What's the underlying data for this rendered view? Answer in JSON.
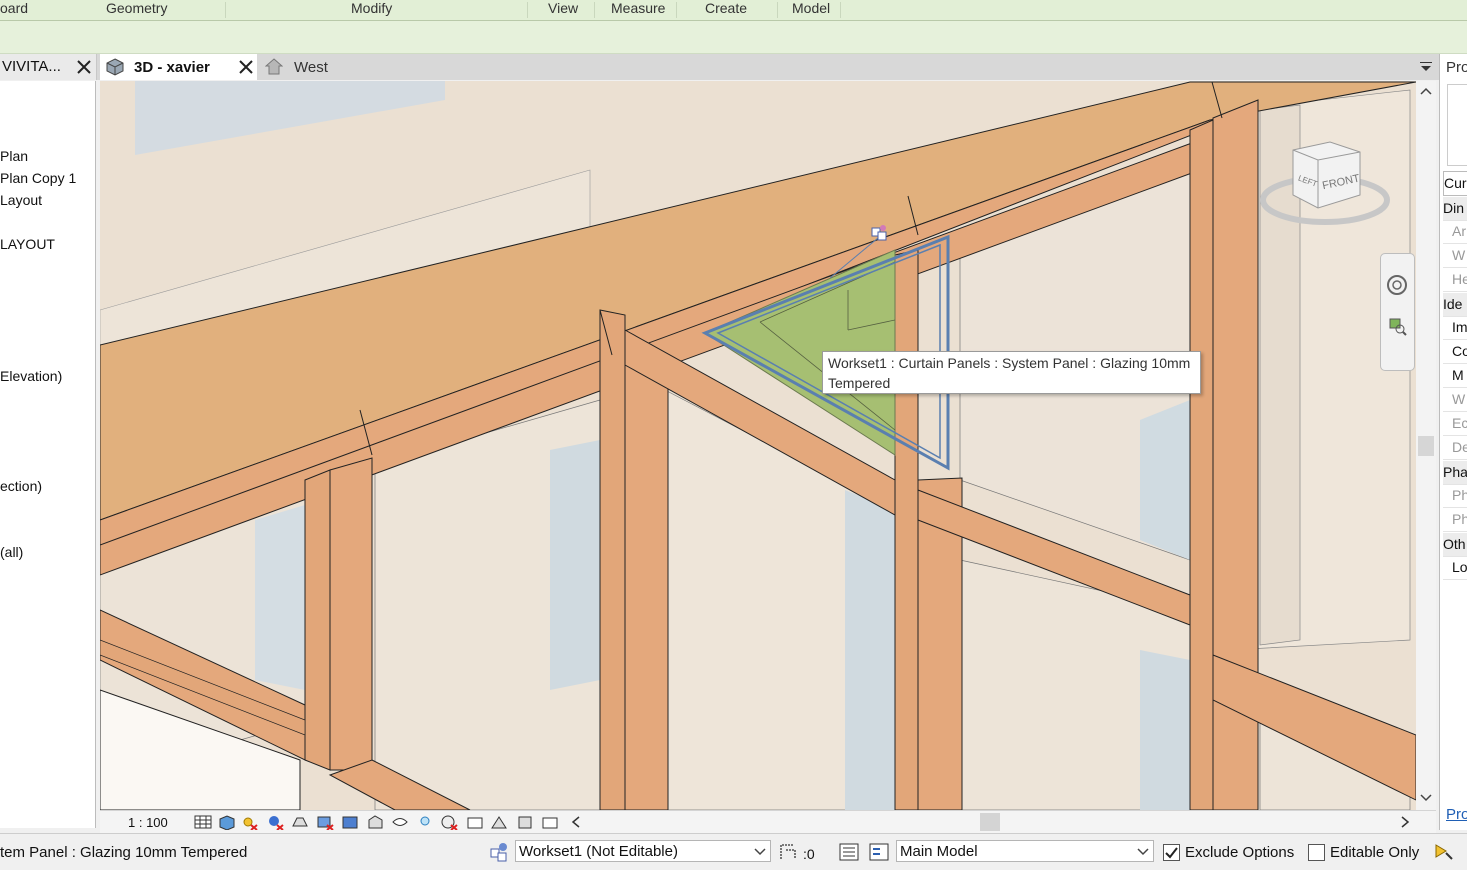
{
  "ribbon": {
    "tabs": [
      "oard",
      "Geometry",
      "Modify",
      "View",
      "Measure",
      "Create",
      "Model"
    ]
  },
  "browser": {
    "title": "VIVITA...",
    "items": [
      "Plan",
      "Plan Copy 1",
      "Layout",
      "LAYOUT",
      "Elevation)",
      "ection)",
      "(all)"
    ]
  },
  "view_tabs": {
    "active": "3D - xavier",
    "inactive": "West"
  },
  "tooltip": {
    "line1": "Workset1 : Curtain Panels : System Panel : Glazing 10mm",
    "line2": "Tempered"
  },
  "view_bar": {
    "scale": "1 : 100"
  },
  "nav_cube": {
    "left": "LEFT",
    "front": "FRONT"
  },
  "properties": {
    "title": "Pro",
    "rows": [
      "Cur",
      "Din",
      "Ar",
      "W",
      "He",
      "Ide",
      "Im",
      "Co",
      "M",
      "W",
      "Ec",
      "De",
      "Pha",
      "Ph",
      "Ph",
      "Oth",
      "Lo"
    ],
    "footer_link": "Pro"
  },
  "status": {
    "selection_text": "tem Panel : Glazing 10mm Tempered",
    "workset": "Workset1 (Not Editable)",
    "design_option_count": ":0",
    "design_option": "Main Model",
    "exclude_options": "Exclude Options",
    "editable_only": "Editable Only"
  },
  "colors": {
    "frame": "#e4a87c",
    "beam_top": "#e1b07d",
    "glazing": "#a6bf72",
    "selection": "#5a7fb0",
    "ribbon": "#e2efd6"
  }
}
